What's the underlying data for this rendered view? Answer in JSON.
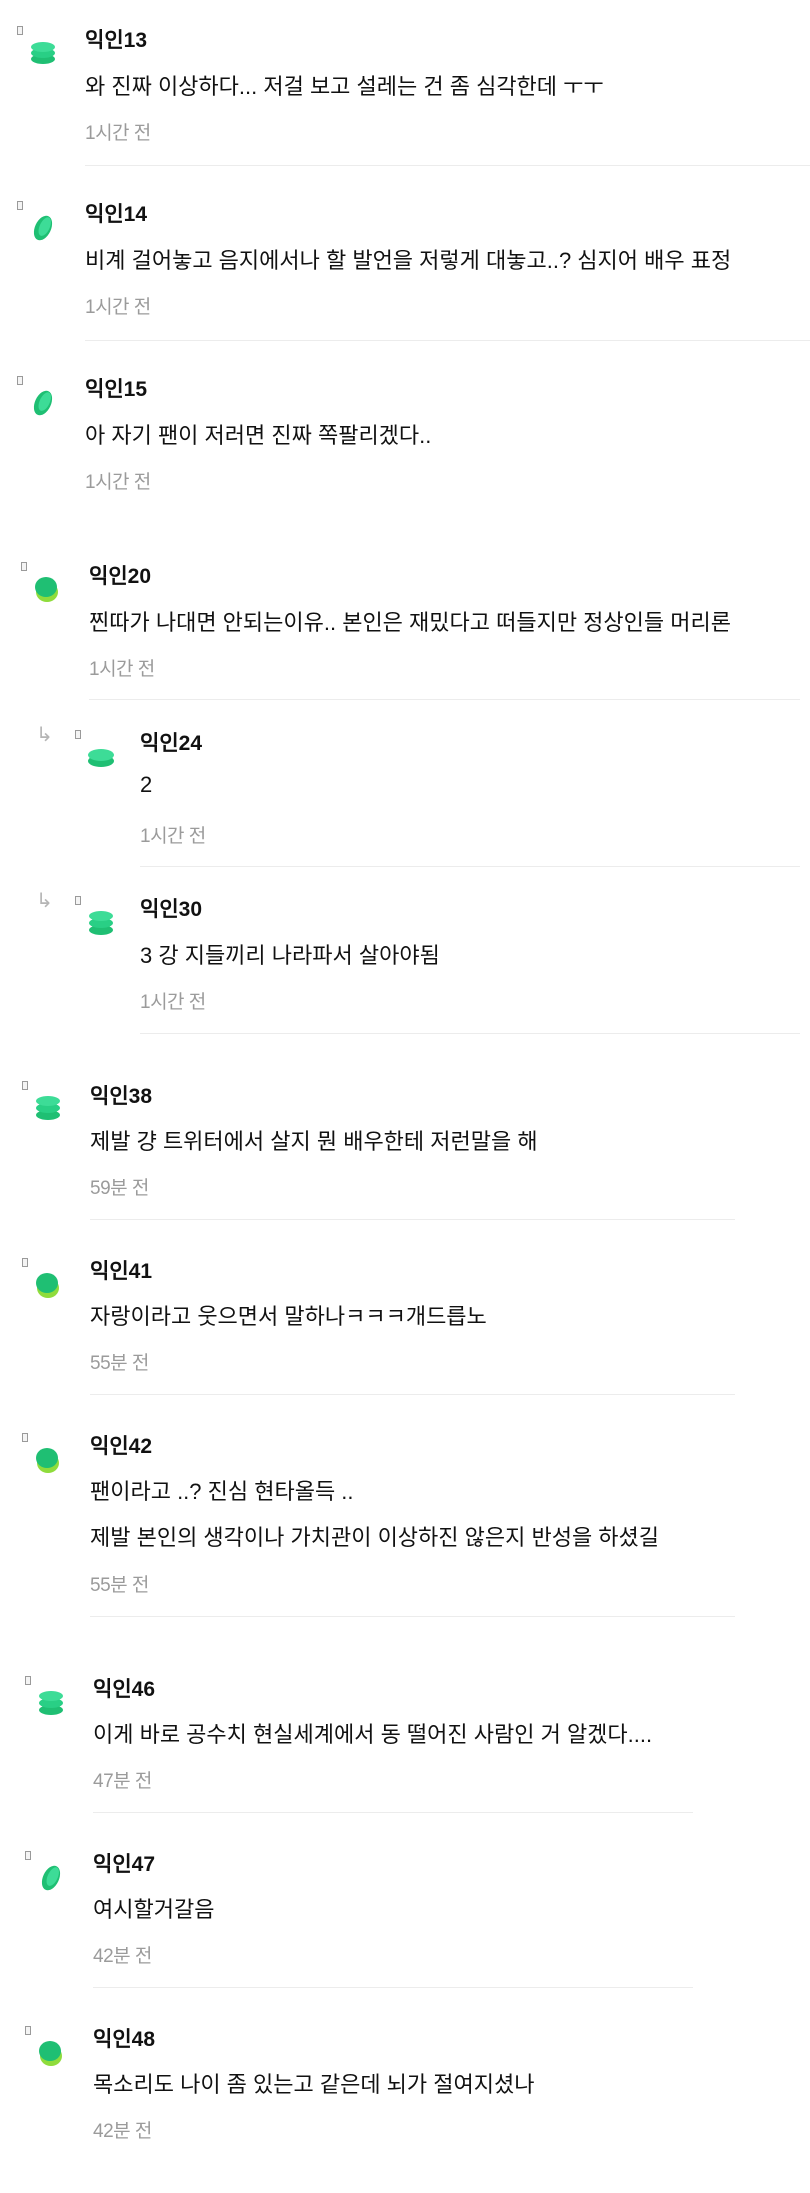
{
  "colors": {
    "avatar_green": "#22c77a",
    "avatar_light": "#2ed8a3",
    "avatar_lime": "#8fdc3c",
    "time_gray": "#9b9b9b",
    "divider": "#ececec"
  },
  "comments": [
    {
      "author": "익인13",
      "lines": [
        "와 진짜 이상하다... 저걸 보고 설레는 건 좀 심각한데 ㅜㅜ"
      ],
      "time": "1시간 전",
      "avatar_icon": "coin-stack-icon"
    },
    {
      "author": "익인14",
      "lines": [
        "비계 걸어놓고 음지에서나 할 발언을 저렇게 대놓고..? 심지어 배우 표정"
      ],
      "time": "1시간 전",
      "avatar_icon": "leaf-icon"
    },
    {
      "author": "익인15",
      "lines": [
        "아 자기 팬이 저러면 진짜 쪽팔리겠다.."
      ],
      "time": "1시간 전",
      "avatar_icon": "leaf-icon"
    },
    {
      "author": "익인20",
      "lines": [
        "찐따가 나대면 안되는이유.. 본인은 재밌다고 떠들지만 정상인들 머리론"
      ],
      "time": "1시간 전",
      "avatar_icon": "blob-icon"
    },
    {
      "author": "익인24",
      "lines": [
        "2"
      ],
      "time": "1시간 전",
      "avatar_icon": "coin-stack-icon",
      "reply": true
    },
    {
      "author": "익인30",
      "lines": [
        "3 강 지들끼리 나라파서 살아야됨"
      ],
      "time": "1시간 전",
      "avatar_icon": "coin-stack-icon",
      "reply": true
    },
    {
      "author": "익인38",
      "lines": [
        "제발 걍 트위터에서 살지 뭔 배우한테 저런말을 해"
      ],
      "time": "59분 전",
      "avatar_icon": "coin-stack-icon"
    },
    {
      "author": "익인41",
      "lines": [
        "자랑이라고 웃으면서 말하나ㅋㅋㅋ개드릅노"
      ],
      "time": "55분 전",
      "avatar_icon": "blob-icon"
    },
    {
      "author": "익인42",
      "lines": [
        "팬이라고 ..? 진심 현타올득 ..",
        "제발 본인의 생각이나 가치관이 이상하진 않은지 반성을 하셨길"
      ],
      "time": "55분 전",
      "avatar_icon": "blob-icon"
    },
    {
      "author": "익인46",
      "lines": [
        "이게 바로 공수치 현실세계에서 동 떨어진 사람인 거 알겠다...."
      ],
      "time": "47분 전",
      "avatar_icon": "coin-stack-icon"
    },
    {
      "author": "익인47",
      "lines": [
        "여시할거갈음"
      ],
      "time": "42분 전",
      "avatar_icon": "leaf-icon"
    },
    {
      "author": "익인48",
      "lines": [
        "목소리도 나이 좀 있는고 같은데 뇌가 절여지셨나"
      ],
      "time": "42분 전",
      "avatar_icon": "blob-icon"
    }
  ]
}
